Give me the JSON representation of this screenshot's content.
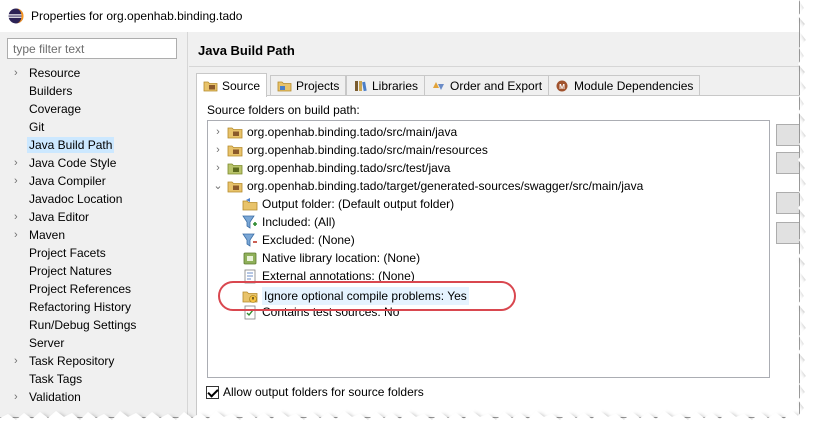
{
  "window": {
    "title": "Properties for org.openhab.binding.tado"
  },
  "sidebar": {
    "filter_placeholder": "type filter text",
    "items": [
      {
        "label": "Resource",
        "expandable": true
      },
      {
        "label": "Builders",
        "expandable": false
      },
      {
        "label": "Coverage",
        "expandable": false
      },
      {
        "label": "Git",
        "expandable": false
      },
      {
        "label": "Java Build Path",
        "expandable": false,
        "selected": true
      },
      {
        "label": "Java Code Style",
        "expandable": true
      },
      {
        "label": "Java Compiler",
        "expandable": true
      },
      {
        "label": "Javadoc Location",
        "expandable": false
      },
      {
        "label": "Java Editor",
        "expandable": true
      },
      {
        "label": "Maven",
        "expandable": true
      },
      {
        "label": "Project Facets",
        "expandable": false
      },
      {
        "label": "Project Natures",
        "expandable": false
      },
      {
        "label": "Project References",
        "expandable": false
      },
      {
        "label": "Refactoring History",
        "expandable": false
      },
      {
        "label": "Run/Debug Settings",
        "expandable": false
      },
      {
        "label": "Server",
        "expandable": false
      },
      {
        "label": "Task Repository",
        "expandable": true
      },
      {
        "label": "Task Tags",
        "expandable": false
      },
      {
        "label": "Validation",
        "expandable": true
      }
    ]
  },
  "main": {
    "title": "Java Build Path",
    "tabs": [
      {
        "label": "Source",
        "icon": "source-folder-icon",
        "active": true
      },
      {
        "label": "Projects",
        "icon": "projects-icon"
      },
      {
        "label": "Libraries",
        "icon": "libraries-icon"
      },
      {
        "label": "Order and Export",
        "icon": "order-export-icon"
      },
      {
        "label": "Module Dependencies",
        "icon": "module-icon"
      }
    ],
    "source_label": "Source folders on build path:",
    "folders": [
      {
        "label": "org.openhab.binding.tado/src/main/java",
        "expanded": false
      },
      {
        "label": "org.openhab.binding.tado/src/main/resources",
        "expanded": false
      },
      {
        "label": "org.openhab.binding.tado/src/test/java",
        "expanded": false
      },
      {
        "label": "org.openhab.binding.tado/target/generated-sources/swagger/src/main/java",
        "expanded": true
      }
    ],
    "attributes": [
      {
        "label": "Output folder: (Default output folder)",
        "icon": "output-folder-icon"
      },
      {
        "label": "Included: (All)",
        "icon": "include-filter-icon"
      },
      {
        "label": "Excluded: (None)",
        "icon": "exclude-filter-icon"
      },
      {
        "label": "Native library location: (None)",
        "icon": "native-library-icon"
      },
      {
        "label": "External annotations: (None)",
        "icon": "annotations-icon"
      },
      {
        "label": "Ignore optional compile problems: Yes",
        "icon": "ignore-problems-icon",
        "highlighted": true
      },
      {
        "label": "Contains test sources: No",
        "icon": "test-sources-icon"
      }
    ],
    "checkbox_label": "Allow output folders for source folders",
    "checkbox_checked": true
  },
  "colors": {
    "accent": "#d9474f",
    "selection": "#cce8ff",
    "window_bg": "#f0f0f0"
  }
}
